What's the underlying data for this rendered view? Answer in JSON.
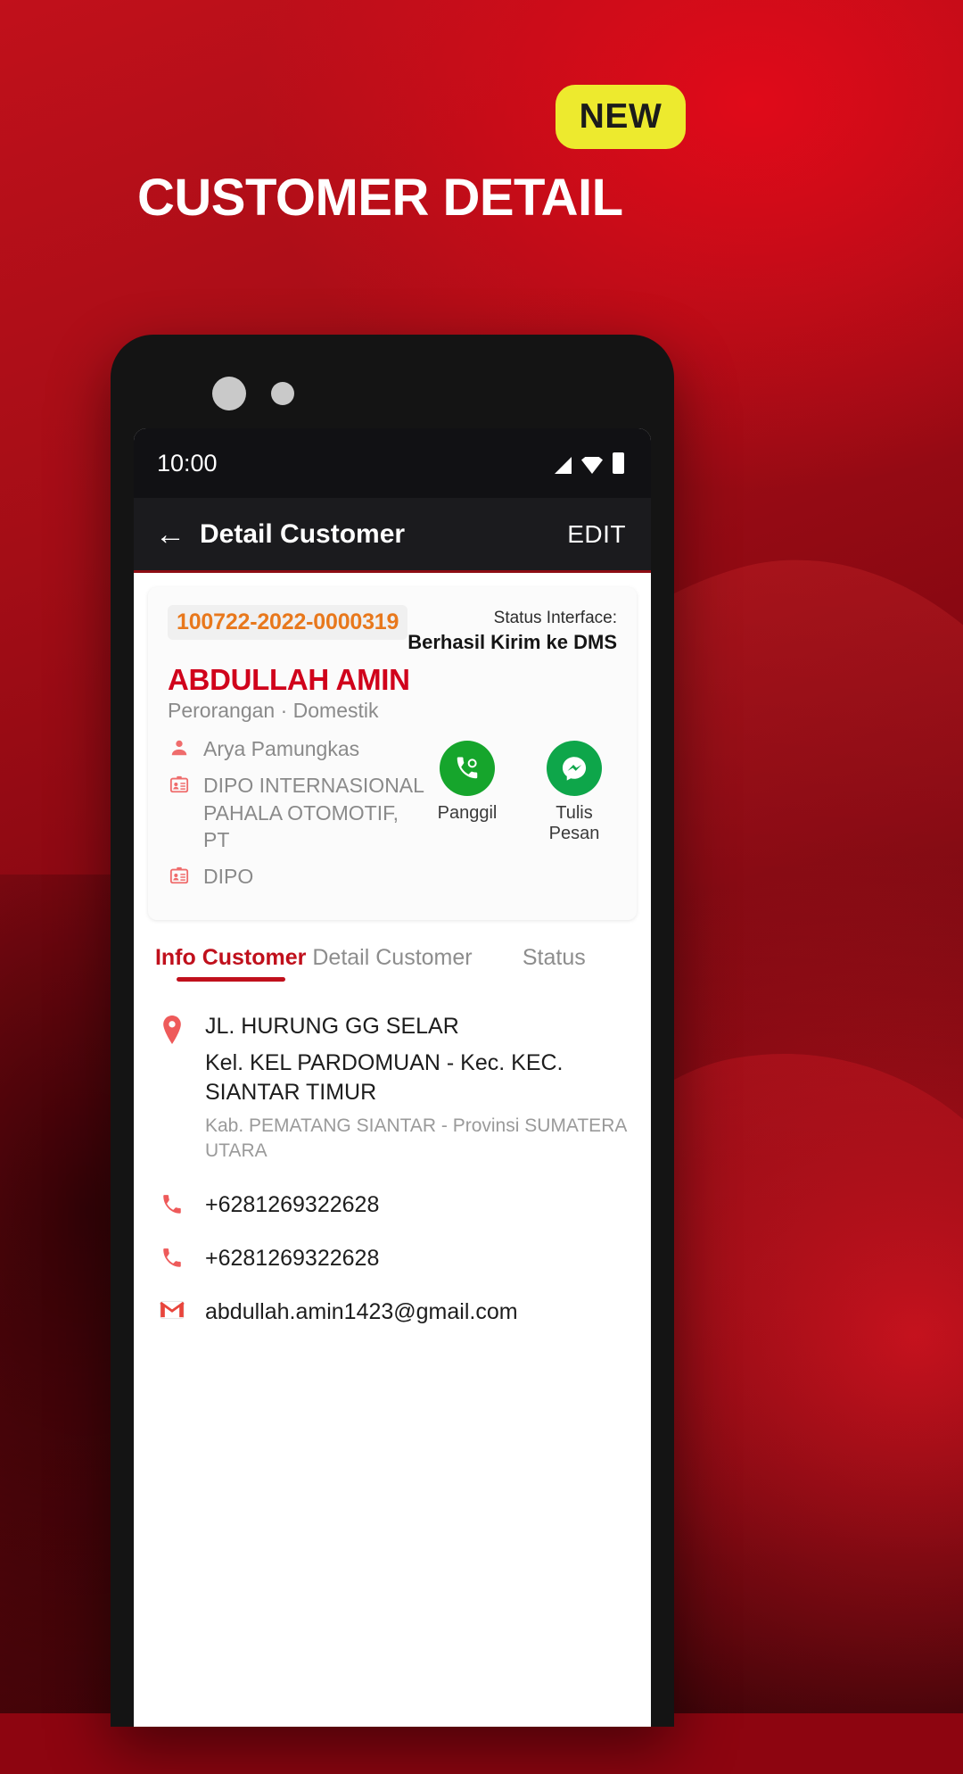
{
  "promo": {
    "badge": "NEW",
    "title": "CUSTOMER DETAIL",
    "badge_bg": "#edea2e",
    "badge_text_color": "#1b1b1b",
    "title_color": "#ffffff",
    "background_color": "#c0101c"
  },
  "phone": {
    "status_bar": {
      "time": "10:00",
      "icons": [
        "signal-icon",
        "wifi-icon",
        "battery-icon"
      ]
    },
    "app_bar": {
      "back_icon": "arrow-left-icon",
      "title": "Detail Customer",
      "action": "EDIT"
    },
    "customer_card": {
      "customer_id": "100722-2022-0000319",
      "customer_id_color": "#e8781c",
      "name": "ABDULLAH AMIN",
      "name_color": "#d0021b",
      "subtitle": "Perorangan · Domestik",
      "status_label": "Status Interface:",
      "status_value": "Berhasil Kirim ke DMS",
      "info_rows": [
        {
          "icon": "person-icon",
          "text": "Arya Pamungkas"
        },
        {
          "icon": "id-card-icon",
          "text": "DIPO INTERNASIONAL PAHALA OTOMOTIF, PT"
        },
        {
          "icon": "id-card-icon",
          "text": "DIPO"
        }
      ],
      "actions": [
        {
          "icon": "phone-call-icon",
          "label": "Panggil",
          "color": "#16a52c"
        },
        {
          "icon": "messenger-icon",
          "label": "Tulis Pesan",
          "color": "#0ea64a"
        }
      ]
    },
    "tabs": [
      {
        "label": "Info Customer",
        "active": true
      },
      {
        "label": "Detail Customer",
        "active": false
      },
      {
        "label": "Status",
        "active": false
      }
    ],
    "details": [
      {
        "icon": "location-pin-icon",
        "line1": "JL. HURUNG GG SELAR",
        "line2": "Kel. KEL PARDOMUAN - Kec. KEC. SIANTAR  TIMUR",
        "line3": "Kab. PEMATANG SIANTAR - Provinsi SUMATERA UTARA"
      },
      {
        "icon": "phone-icon",
        "line1": "+6281269322628"
      },
      {
        "icon": "phone-icon",
        "line1": "+6281269322628"
      },
      {
        "icon": "gmail-icon",
        "line1": "abdullah.amin1423@gmail.com"
      }
    ]
  }
}
